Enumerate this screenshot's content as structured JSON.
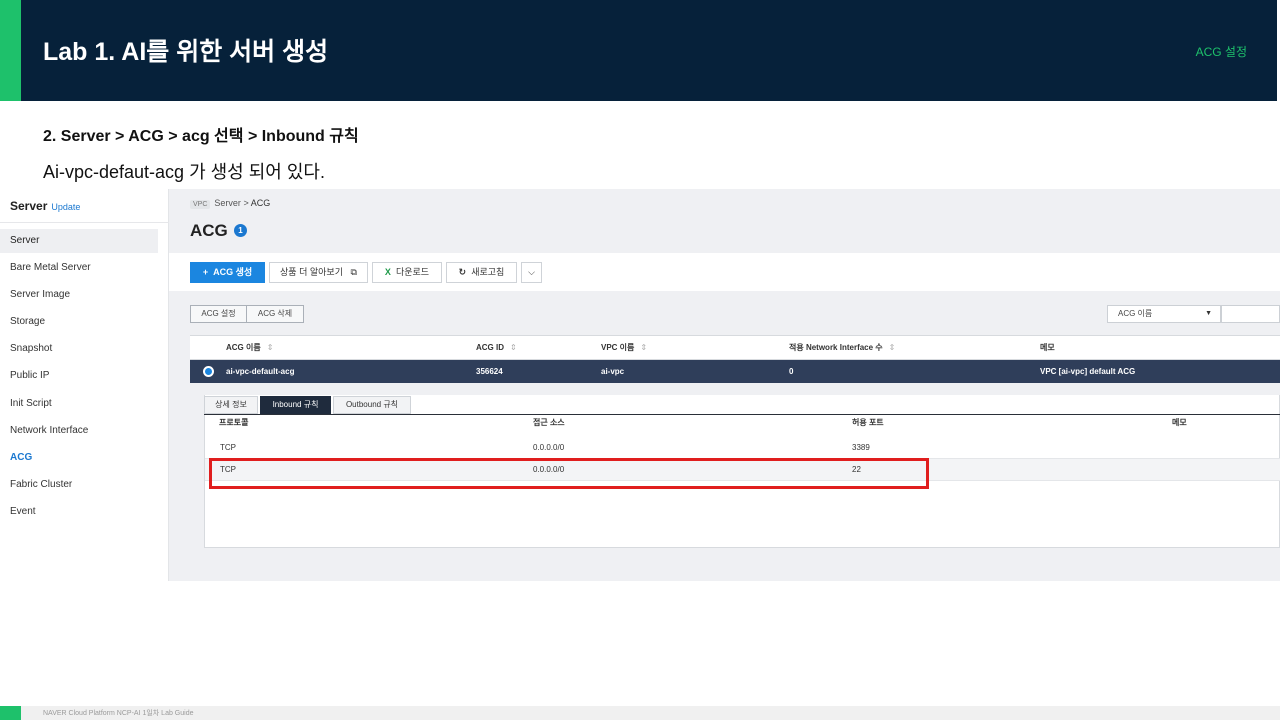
{
  "slide": {
    "title": "Lab 1. AI를 위한 서버 생성",
    "tag": "ACG 설정",
    "step": "2. Server > ACG >  acg 선택 > Inbound 규칙",
    "description": "Ai-vpc-defaut-acg 가 생성 되어 있다.",
    "footer": "NAVER Cloud Platform  NCP-AI 1일차 Lab Guide",
    "colors": {
      "header_bg": "#06213a",
      "accent_green": "#1ec16b",
      "highlight_red": "#e01e1e",
      "primary_blue": "#1b86e0",
      "selected_row": "#2f3e5a"
    }
  },
  "console": {
    "sidebar": {
      "title": "Server",
      "update_label": "Update",
      "items": [
        {
          "label": "Server"
        },
        {
          "label": "Bare Metal Server"
        },
        {
          "label": "Server Image"
        },
        {
          "label": "Storage"
        },
        {
          "label": "Snapshot"
        },
        {
          "label": "Public IP"
        },
        {
          "label": "Init Script"
        },
        {
          "label": "Network Interface"
        },
        {
          "label": "ACG"
        },
        {
          "label": "Fabric Cluster"
        },
        {
          "label": "Event"
        }
      ],
      "active_item": "ACG"
    },
    "breadcrumb": {
      "platform": "VPC",
      "section": "Server",
      "separator": ">",
      "current": "ACG"
    },
    "page_title": "ACG",
    "page_badge": "1",
    "toolbar": {
      "create_icon": "+",
      "create_label": "ACG 생성",
      "learn_more_label": "상품 더 알아보기",
      "learn_more_icon": "⧉",
      "download_icon": "X",
      "download_label": "다운로드",
      "refresh_icon": "↻",
      "refresh_label": "새로고침",
      "more_icon": "⌵"
    },
    "acg_actions": {
      "settings_label": "ACG 설정",
      "delete_label": "ACG 삭제"
    },
    "filter": {
      "selected": "ACG 이름",
      "arrow": "▼"
    },
    "acg_table": {
      "sort_icon": "⇕",
      "columns": [
        "ACG 이름",
        "ACG ID",
        "VPC 이름",
        "적용 Network Interface 수",
        "메모"
      ],
      "rows": [
        {
          "name": "ai-vpc-default-acg",
          "id": "356624",
          "vpc": "ai-vpc",
          "ni_count": "0",
          "memo": "VPC [ai-vpc] default ACG"
        }
      ]
    },
    "detail_tabs": [
      {
        "label": "상세 정보"
      },
      {
        "label": "Inbound 규칙"
      },
      {
        "label": "Outbound 규칙"
      }
    ],
    "active_tab": "Inbound 규칙",
    "rules_table": {
      "columns": [
        "프로토콜",
        "접근 소스",
        "허용 포트",
        "메모"
      ],
      "rows": [
        {
          "protocol": "TCP",
          "source": "0.0.0.0/0",
          "port": "3389",
          "memo": ""
        },
        {
          "protocol": "TCP",
          "source": "0.0.0.0/0",
          "port": "22",
          "memo": ""
        }
      ],
      "highlighted_row": 2
    }
  }
}
